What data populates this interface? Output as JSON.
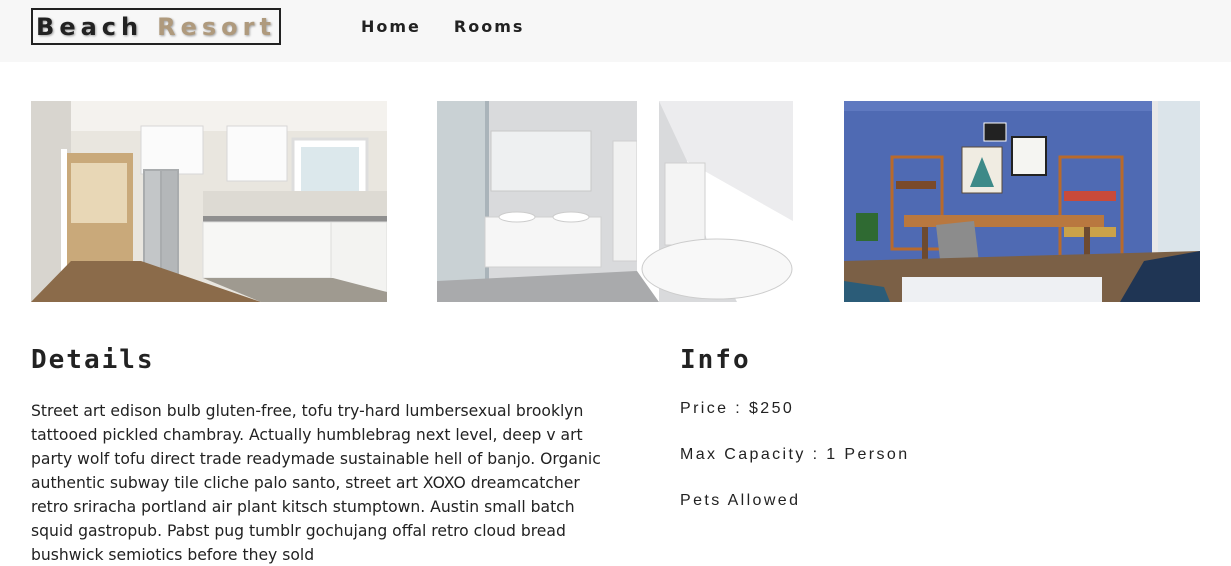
{
  "navbar": {
    "logo_word1": "Beach",
    "logo_word2": "Resort",
    "links": [
      {
        "label": "Home"
      },
      {
        "label": "Rooms"
      }
    ]
  },
  "gallery": {
    "images": [
      {
        "subject": "kitchen"
      },
      {
        "subject": "bathroom"
      },
      {
        "subject": "office"
      }
    ]
  },
  "details": {
    "title": "Details",
    "text": "Street art edison bulb gluten-free, tofu try-hard lumbersexual brooklyn tattooed pickled chambray. Actually humblebrag next level, deep v art party wolf tofu direct trade readymade sustainable hell of banjo. Organic authentic subway tile cliche palo santo, street art XOXO dreamcatcher retro sriracha portland air plant kitsch stumptown. Austin small batch squid gastropub. Pabst pug tumblr gochujang offal retro cloud bread bushwick semiotics before they sold"
  },
  "info": {
    "title": "Info",
    "price": "Price : $250",
    "capacity": "Max Capacity : 1 Person",
    "pets": "Pets Allowed"
  },
  "colors": {
    "navbar_bg": "#f7f7f7",
    "primary_text": "#222222",
    "logo_accent": "#af9a7d"
  }
}
